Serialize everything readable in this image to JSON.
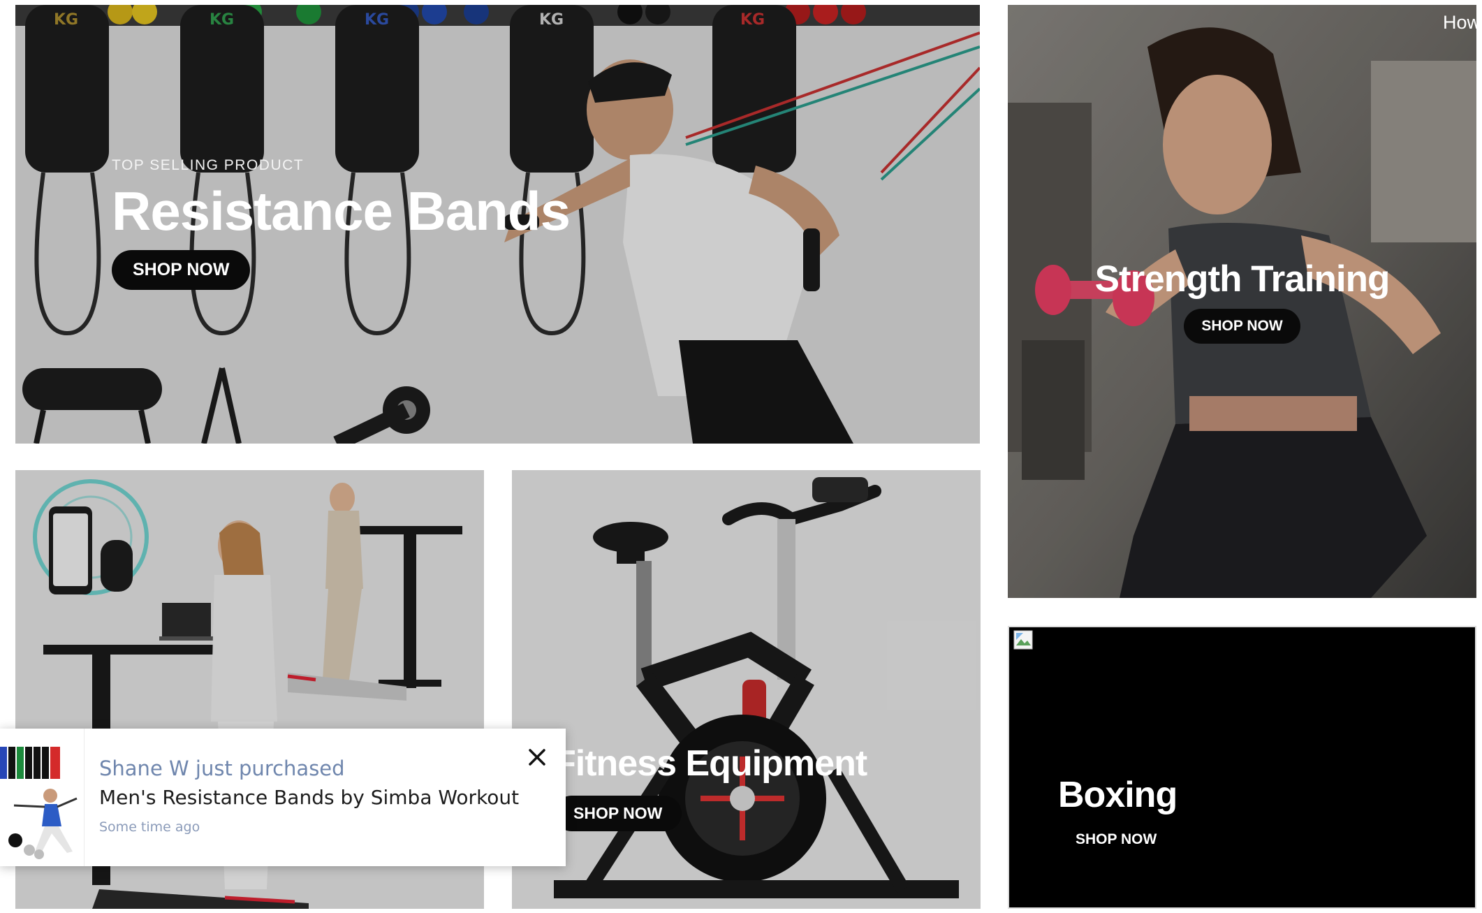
{
  "banners": [
    {
      "eyebrow": "TOP SELLING PRODUCT",
      "title": "Resistance Bands",
      "cta": "SHOP NOW"
    },
    {
      "title": "Strength Training",
      "cta": "SHOP NOW",
      "nav_peek_text": "How"
    },
    {
      "title": "",
      "cta": ""
    },
    {
      "title": "Fitness Equipment",
      "cta": "SHOP NOW"
    },
    {
      "title": "Boxing",
      "cta": "SHOP NOW",
      "image_status": "broken-image"
    }
  ],
  "sales_popup": {
    "purchaser_text": "Shane W just purchased",
    "product_name": "Men's Resistance Bands by Simba Workout",
    "time_text": "Some time ago",
    "close_icon": "close-icon"
  },
  "colors": {
    "cta_background": "#0a0a0a",
    "cta_text": "#ffffff",
    "popup_accent": "#6f86ad"
  }
}
